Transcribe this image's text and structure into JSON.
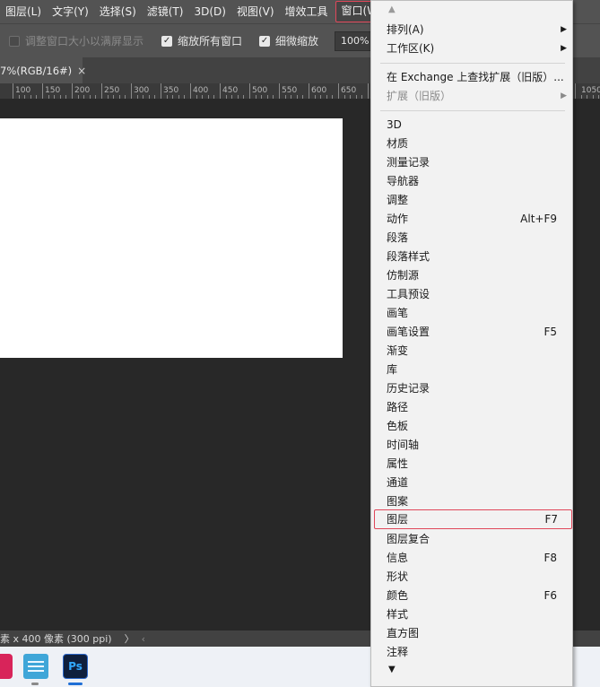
{
  "menubar": {
    "items": [
      {
        "label": "图层(L)"
      },
      {
        "label": "文字(Y)"
      },
      {
        "label": "选择(S)"
      },
      {
        "label": "滤镜(T)"
      },
      {
        "label": "3D(D)"
      },
      {
        "label": "视图(V)"
      },
      {
        "label": "增效工具"
      },
      {
        "label": "窗口(W)"
      }
    ]
  },
  "options": {
    "fit_window_label": "调整窗口大小以满屏显示",
    "zoom_all_label": "缩放所有窗口",
    "scrubby_zoom_label": "细微缩放",
    "zoom_value": "100%"
  },
  "document_tab": {
    "label": "7%(RGB/16#)",
    "close": "×"
  },
  "ruler": {
    "labels": [
      "100",
      "150",
      "200",
      "250",
      "300",
      "350",
      "400",
      "450",
      "500",
      "550",
      "600",
      "650",
      "1050"
    ]
  },
  "statusbar": {
    "text": "素 x 400 像素 (300 ppi)",
    "arrow_right": "〉",
    "arrow_left": "‹"
  },
  "taskbar": {
    "ps_label": "Ps"
  },
  "window_menu": {
    "scroll_up": "▲",
    "scroll_down": "▼",
    "items": [
      {
        "label": "排列(A)",
        "submenu": "▶"
      },
      {
        "label": "工作区(K)",
        "submenu": "▶"
      },
      {
        "label": "在 Exchange 上查找扩展（旧版）..."
      },
      {
        "label": "扩展（旧版）",
        "submenu": "▶"
      },
      {
        "label": "3D"
      },
      {
        "label": "材质"
      },
      {
        "label": "测量记录"
      },
      {
        "label": "导航器"
      },
      {
        "label": "调整"
      },
      {
        "label": "动作",
        "shortcut": "Alt+F9"
      },
      {
        "label": "段落"
      },
      {
        "label": "段落样式"
      },
      {
        "label": "仿制源"
      },
      {
        "label": "工具预设"
      },
      {
        "label": "画笔"
      },
      {
        "label": "画笔设置",
        "shortcut": "F5"
      },
      {
        "label": "渐变"
      },
      {
        "label": "库"
      },
      {
        "label": "历史记录"
      },
      {
        "label": "路径"
      },
      {
        "label": "色板"
      },
      {
        "label": "时间轴"
      },
      {
        "label": "属性"
      },
      {
        "label": "通道"
      },
      {
        "label": "图案"
      },
      {
        "label": "图层",
        "shortcut": "F7"
      },
      {
        "label": "图层复合"
      },
      {
        "label": "信息",
        "shortcut": "F8"
      },
      {
        "label": "形状"
      },
      {
        "label": "颜色",
        "shortcut": "F6"
      },
      {
        "label": "样式"
      },
      {
        "label": "直方图"
      },
      {
        "label": "注释"
      }
    ]
  }
}
